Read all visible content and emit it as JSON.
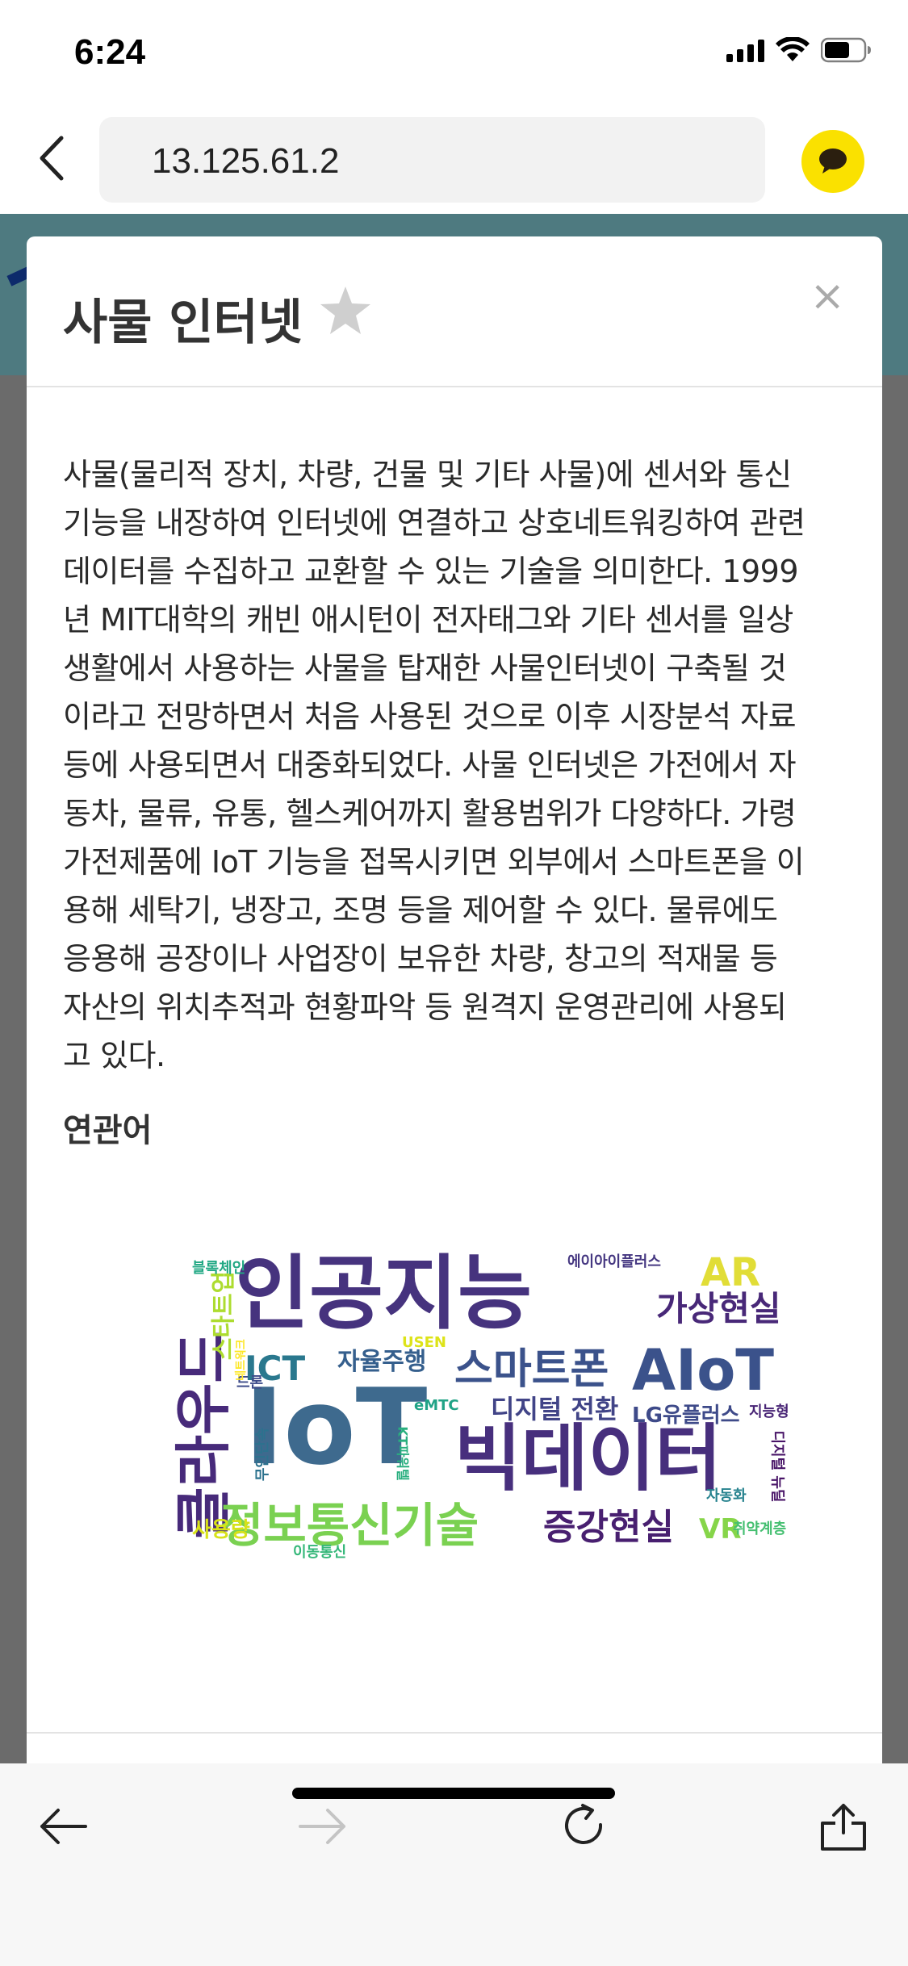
{
  "status_bar": {
    "time": "6:24"
  },
  "browser": {
    "url": "13.125.61.2"
  },
  "modal": {
    "title": "사물 인터넷",
    "close_symbol": "×",
    "body_lines": [
      "사물(물리적 장치, 차량, 건물 및 기타 사물)에 센서와 통신",
      "기능을 내장하여 인터넷에 연결하고 상호네트워킹하여 관련",
      "데이터를 수집하고 교환할 수 있는 기술을 의미한다. 1999",
      "년 MIT대학의 캐빈 애시턴이 전자태그와 기타 센서를 일상",
      "생활에서 사용하는 사물을 탑재한 사물인터넷이 구축될 것",
      "이라고 전망하면서 처음 사용된 것으로 이후 시장분석 자료",
      "등에 사용되면서 대중화되었다. 사물 인터넷은 가전에서 자",
      "동차, 물류, 유통, 헬스케어까지 활용범위가 다양하다. 가령",
      "가전제품에 IoT 기능을 접목시키면 외부에서 스마트폰을 이",
      "용해 세탁기, 냉장고, 조명 등을 제어할 수 있다. 물류에도",
      "응용해 공장이나 사업장이 보유한 차량, 창고의 적재물 등",
      "자산의 위치추적과 현황파악 등 원격지 운영관리에 사용되",
      "고 있다."
    ],
    "related_heading": "연관어"
  },
  "wordcloud": {
    "words": [
      {
        "text": "IoT",
        "color": "#3e6a8e"
      },
      {
        "text": "인공지능",
        "color": "#46337e"
      },
      {
        "text": "빅데이터",
        "color": "#472f7d"
      },
      {
        "text": "클라우드",
        "color": "#472a7a"
      },
      {
        "text": "정보통신기술",
        "color": "#7ad151"
      },
      {
        "text": "스마트폰",
        "color": "#3b528b"
      },
      {
        "text": "AIoT",
        "color": "#3b528b"
      },
      {
        "text": "가상현실",
        "color": "#482878"
      },
      {
        "text": "증강현실",
        "color": "#481f70"
      },
      {
        "text": "디지털 전환",
        "color": "#414487"
      },
      {
        "text": "LG유플러스",
        "color": "#3e4a89"
      },
      {
        "text": "AR",
        "color": "#e1dd37"
      },
      {
        "text": "ICT",
        "color": "#2a788e"
      },
      {
        "text": "자율주행",
        "color": "#355f8d"
      },
      {
        "text": "스타트업",
        "color": "#addc30"
      },
      {
        "text": "블록체인",
        "color": "#22a884"
      },
      {
        "text": "에이아이플러스",
        "color": "#453781"
      },
      {
        "text": "USEN",
        "color": "#dde318"
      },
      {
        "text": "eMTC",
        "color": "#20a386"
      },
      {
        "text": "드론",
        "color": "#3e4c8a"
      },
      {
        "text": "네트워크",
        "color": "#fde725"
      },
      {
        "text": "무인단속",
        "color": "#2c728e"
      },
      {
        "text": "KT파워텔",
        "color": "#29af7f"
      },
      {
        "text": "VR",
        "color": "#86d549"
      },
      {
        "text": "취약계층",
        "color": "#44bf70"
      },
      {
        "text": "자동화",
        "color": "#26828e"
      },
      {
        "text": "디지털 뉴딜",
        "color": "#481467"
      },
      {
        "text": "지능형",
        "color": "#482475"
      },
      {
        "text": "사용량",
        "color": "#d8e219"
      },
      {
        "text": "이동통신",
        "color": "#35b779"
      }
    ]
  },
  "toolbar": {
    "icons": [
      "back-arrow-icon",
      "forward-arrow-icon",
      "reload-icon",
      "share-icon"
    ]
  }
}
